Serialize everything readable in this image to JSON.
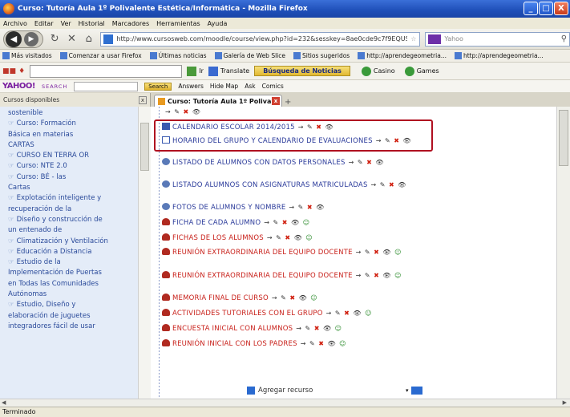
{
  "window": {
    "title": "Curso: Tutoría Aula 1º Polivalente Estética/Informática - Mozilla Firefox",
    "min": "_",
    "max": "□",
    "close": "X"
  },
  "menu": [
    "Archivo",
    "Editar",
    "Ver",
    "Historial",
    "Marcadores",
    "Herramientas",
    "Ayuda"
  ],
  "nav": {
    "url": "http://www.cursosweb.com/moodle/course/view.php?id=232&sesskey=8ae0cde9c7f9EQUS#NE",
    "search_placeholder": "Yahoo"
  },
  "bookmarks": [
    "Más visitados",
    "Comenzar a usar Firefox",
    "Últimas noticias",
    "Galería de Web Slice",
    "Sitios sugeridos",
    "http://aprendegeometria...",
    "http://aprendegeometria..."
  ],
  "toolbar2": {
    "go_label": "Ir",
    "translate_label": "Translate",
    "busqueda_label": "Búsqueda de Noticias",
    "items": [
      "Casino",
      "Games"
    ]
  },
  "yahoo": {
    "logo": "YAHOO!",
    "search_label": "SEARCH",
    "search_btn": "Search",
    "links": [
      "Answers",
      "Hide Map",
      "Ask",
      "Comics"
    ]
  },
  "tabs": {
    "side_title": "Cursos disponibles",
    "side_close": "x",
    "active": "Curso: Tutoría Aula 1º Polivalente...",
    "active_close": "x",
    "new_tab": "+"
  },
  "sidebar": {
    "items": [
      "sostenible",
      "Curso: Formación",
      "Básica en materias",
      "CARTAS",
      "CURSO EN TERRA OR",
      "Curso: NTE 2.0",
      "Curso: BÉ - las",
      "Cartas",
      "Explotación inteligente y",
      "recuperación de la",
      "Diseño y construcción de",
      "un entenado de",
      "Climatización y Ventilación",
      "Educación a Distancia",
      "Estudio de la",
      "Implementación de Puertas",
      "en Todas las Comunidades",
      "Autónomas",
      "Estudio, Diseño y",
      "elaboración de juguetes",
      "integradores fácil de usar"
    ]
  },
  "resources": [
    {
      "label": "CALENDARIO ESCOLAR 2014/2015",
      "color": "blue",
      "icon": "book-icon"
    },
    {
      "label": "HORARIO DEL GRUPO Y CALENDARIO DE EVALUACIONES",
      "color": "blue",
      "icon": "folder-icon"
    },
    {
      "label": "LISTADO DE ALUMNOS CON DATOS PERSONALES",
      "color": "blue",
      "icon": "globe-icon"
    },
    {
      "label": "LISTADO ALUMNOS CON ASIGNATURAS MATRICULADAS",
      "color": "blue",
      "icon": "globe-icon"
    },
    {
      "label": "FOTOS DE ALUMNOS Y NOMBRE",
      "color": "blue",
      "icon": "globe-icon"
    },
    {
      "label": "FICHA DE CADA ALUMNO",
      "color": "blue",
      "icon": "users-icon"
    },
    {
      "label": "FICHAS DE LOS ALUMNOS",
      "color": "red",
      "icon": "users-icon"
    },
    {
      "label": "REUNIÓN EXTRAORDINARIA DEL EQUIPO DOCENTE",
      "color": "red",
      "icon": "users-icon"
    },
    {
      "label": "REUNIÓN EXTRAORDINARIA DEL EQUIPO DOCENTE",
      "color": "red",
      "icon": "users-icon"
    },
    {
      "label": "MEMORIA FINAL DE CURSO",
      "color": "red",
      "icon": "users-icon"
    },
    {
      "label": "ACTIVIDADES TUTORIALES CON EL GRUPO",
      "color": "red",
      "icon": "users-icon"
    },
    {
      "label": "ENCUESTA INICIAL CON ALUMNOS",
      "color": "red",
      "icon": "users-icon"
    },
    {
      "label": "REUNIÓN INICIAL CON LOS PADRES",
      "color": "red",
      "icon": "users-icon"
    }
  ],
  "editing": {
    "move": "→",
    "edit": "✎",
    "hide": "👁",
    "delete": "✖",
    "roles": "☺"
  },
  "bottom": {
    "add_resource": "Agregar recurso",
    "select_arrow": "▾"
  },
  "status": "Terminado"
}
